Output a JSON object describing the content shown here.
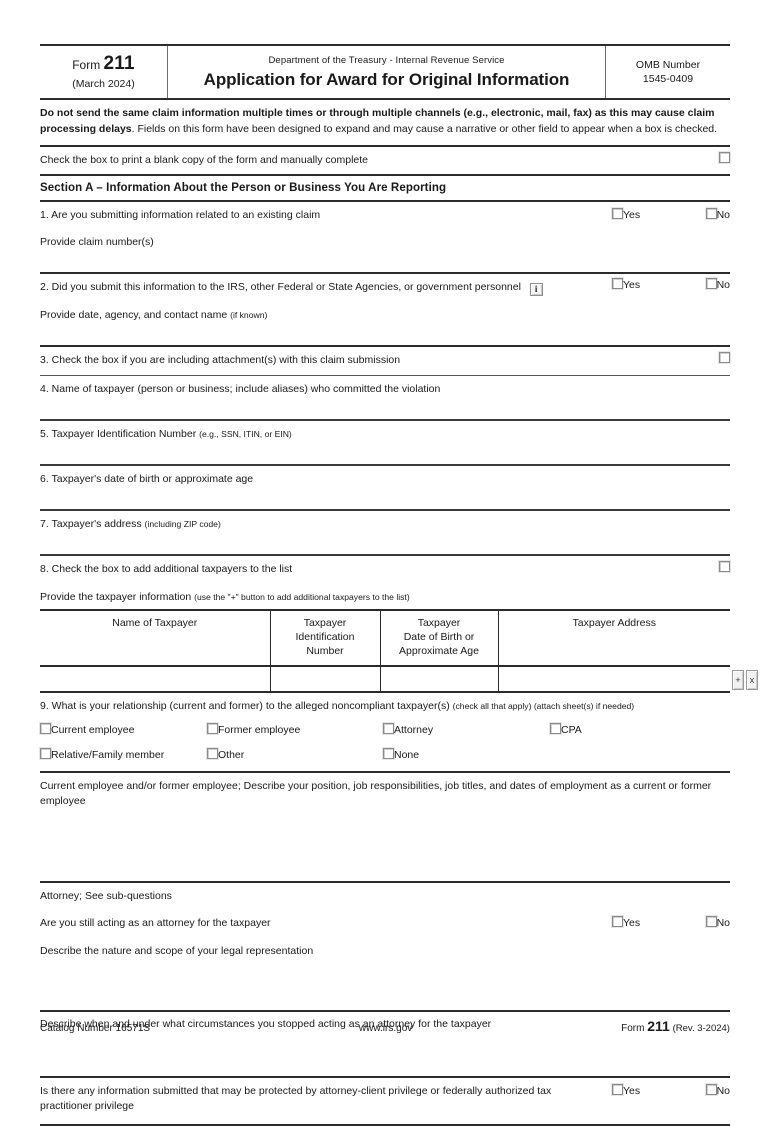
{
  "header": {
    "form_label": "Form",
    "form_number": "211",
    "revision_date": "(March 2024)",
    "department": "Department of the Treasury - Internal Revenue Service",
    "title": "Application for Award for Original Information",
    "omb_label": "OMB Number",
    "omb_number": "1545-0409"
  },
  "notice": {
    "bold_part": "Do not send the same claim information multiple times or through multiple channels (e.g., electronic, mail, fax) as this may cause claim processing delays",
    "rest_part": ". Fields on this form have been designed to expand and may cause a narrative or other field to appear when a box is checked."
  },
  "print_row": {
    "label": "Check the box to print a blank copy of the form and manually complete"
  },
  "section_a": {
    "title": "Section A – Information About the Person or Business You Are Reporting"
  },
  "labels": {
    "yes": "Yes",
    "no": "No",
    "info": "i",
    "add_row": "+",
    "remove_row": "x"
  },
  "questions": {
    "q1": {
      "text": "1. Are you submitting information related to an existing claim",
      "sub": "Provide claim number(s)"
    },
    "q2": {
      "text": "2. Did you submit this information to the IRS, other Federal or State Agencies, or government personnel",
      "sub_main": "Provide date, agency, and contact name ",
      "sub_small": "(if known)"
    },
    "q3": {
      "text": "3. Check the box if you are including attachment(s) with this claim submission"
    },
    "q4": {
      "text": "4. Name of taxpayer (person or business; include aliases) who committed the violation"
    },
    "q5": {
      "main": "5. Taxpayer Identification Number ",
      "small": "(e.g., SSN, ITIN, or EIN)"
    },
    "q6": {
      "text": "6. Taxpayer's date of birth or approximate age"
    },
    "q7": {
      "main": "7. Taxpayer's address ",
      "small": "(including ZIP code)"
    },
    "q8": {
      "text": "8. Check the box to add additional taxpayers to the list",
      "sub_main": "Provide the taxpayer information ",
      "sub_small": "(use the \"+\" button to add additional taxpayers to the list)"
    },
    "q9": {
      "main": "9. What is your relationship (current and former) to the alleged noncompliant taxpayer(s) ",
      "small": "(check all that apply) (attach sheet(s) if needed)",
      "options": [
        "Current employee",
        "Former employee",
        "Attorney",
        "CPA",
        "Relative/Family member",
        "Other",
        "None"
      ]
    }
  },
  "taxpayer_table": {
    "columns": [
      "Name of Taxpayer",
      "Taxpayer\nIdentification\nNumber",
      "Taxpayer\nDate of Birth or\nApproximate Age",
      "Taxpayer Address"
    ],
    "col_name": "Name of Taxpayer",
    "col_tin_l1": "Taxpayer",
    "col_tin_l2": "Identification",
    "col_tin_l3": "Number",
    "col_dob_l1": "Taxpayer",
    "col_dob_l2": "Date of Birth or",
    "col_dob_l3": "Approximate Age",
    "col_address": "Taxpayer Address",
    "rows": [
      {
        "name": "",
        "tin": "",
        "dob": "",
        "address": ""
      }
    ]
  },
  "employee_narrative": {
    "text": "Current employee and/or former employee; Describe your position, job responsibilities, job titles, and dates of employment as a current or former employee"
  },
  "attorney": {
    "heading": "Attorney; See sub-questions",
    "still_acting": "Are you still acting as an attorney for the taxpayer",
    "describe_nature": "Describe the nature and scope of your legal representation",
    "describe_stopped": "Describe when and under what circumstances you stopped acting as an attorney for the taxpayer"
  },
  "privilege": {
    "text": "Is there any information submitted that may be protected by attorney-client privilege or federally authorized tax practitioner privilege"
  },
  "footer": {
    "catalog": "Catalog Number 16571S",
    "website": "www.irs.gov",
    "form_label": "Form",
    "form_number": "211",
    "revision": "(Rev. 3-2024)"
  }
}
